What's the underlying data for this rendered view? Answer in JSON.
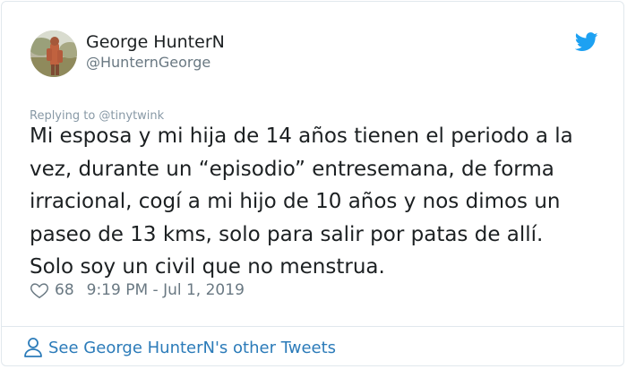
{
  "author": {
    "name": "George HunterN",
    "handle": "@HunternGeorge",
    "avatar_icon": "profile-photo"
  },
  "reply_context": "Replying to @tinytwink",
  "tweet": {
    "text": "Mi esposa y mi hija de 14 años tienen el periodo a la\nvez, durante un “episodio” entresemana, de forma\nirracional, cogí a mi hijo de 10 años y nos dimos un\npaseo de 13 kms, solo para salir por patas de allí.\nSolo soy un civil que no menstrua.",
    "likes": "68",
    "timestamp": "9:19 PM - Jul 1, 2019"
  },
  "footer": {
    "other_tweets_label": "See George HunterN's other Tweets"
  },
  "colors": {
    "twitter_blue": "#1da1f2",
    "link_blue": "#2b7bb9",
    "muted_gray": "#697882",
    "border": "#e1e8ed"
  }
}
